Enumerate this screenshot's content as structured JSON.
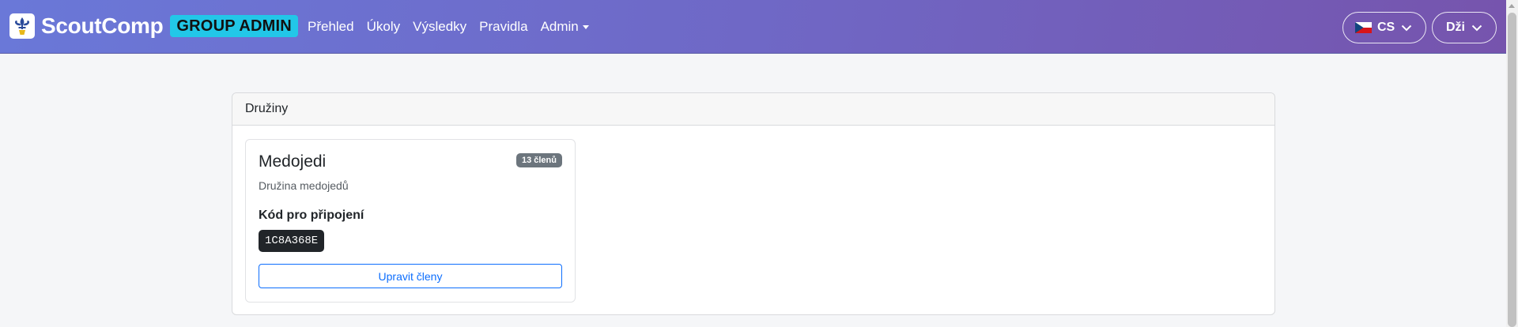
{
  "navbar": {
    "brand": "ScoutComp",
    "role_badge": "GROUP ADMIN",
    "links": [
      {
        "label": "Přehled"
      },
      {
        "label": "Úkoly"
      },
      {
        "label": "Výsledky"
      },
      {
        "label": "Pravidla"
      },
      {
        "label": "Admin"
      }
    ],
    "language": {
      "label": "CS",
      "flag_icon": "czech-flag-icon"
    },
    "user": {
      "label": "Dži"
    }
  },
  "colors": {
    "navbar_gradient_start": "#6a78d8",
    "navbar_gradient_end": "#7654ad",
    "role_badge": "#22c7e8",
    "primary": "#0d6efd",
    "badge_secondary": "#6c757d",
    "code_background": "#212529"
  },
  "teams_section": {
    "title": "Družiny",
    "teams": [
      {
        "name": "Medojedi",
        "member_count": "13 členů",
        "description": "Družina medojedů",
        "join_code_label": "Kód pro připojení",
        "join_code": "1C8A368E",
        "edit_button": "Upravit členy"
      }
    ]
  }
}
